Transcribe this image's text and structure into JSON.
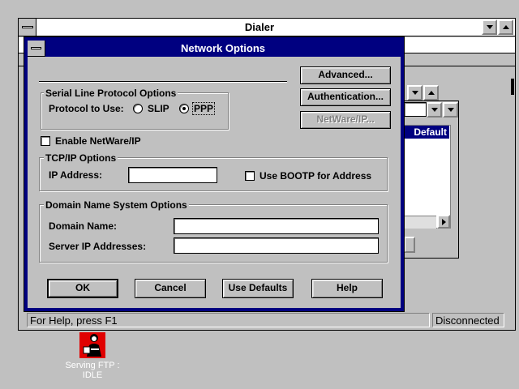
{
  "dialer": {
    "title": "Dialer",
    "status_left": "For Help, press F1",
    "status_right": "Disconnected",
    "list_header": "Default"
  },
  "dialog": {
    "title": "Network Options",
    "buttons": {
      "advanced": "Advanced...",
      "authentication": "Authentication...",
      "netware_ip": "NetWare/IP...",
      "ok": "OK",
      "cancel": "Cancel",
      "use_defaults": "Use Defaults",
      "help": "Help"
    },
    "serial": {
      "group_label": "Serial Line Protocol Options",
      "protocol_label": "Protocol to Use:",
      "options": [
        "SLIP",
        "PPP"
      ],
      "selected": "PPP"
    },
    "netware_checkbox": {
      "label": "Enable NetWare/IP",
      "checked": false
    },
    "tcpip": {
      "group_label": "TCP/IP Options",
      "ip_label": "IP Address:",
      "ip_value": "",
      "bootp_label": "Use BOOTP for Address",
      "bootp_checked": false
    },
    "dns": {
      "group_label": "Domain Name System Options",
      "domain_label": "Domain Name:",
      "domain_value": "",
      "servers_label": "Server IP Addresses:",
      "servers_value": ""
    }
  },
  "desktop": {
    "icon_name": "ftp-server-icon",
    "icon_label_line1": "Serving FTP :",
    "icon_label_line2": "IDLE"
  }
}
